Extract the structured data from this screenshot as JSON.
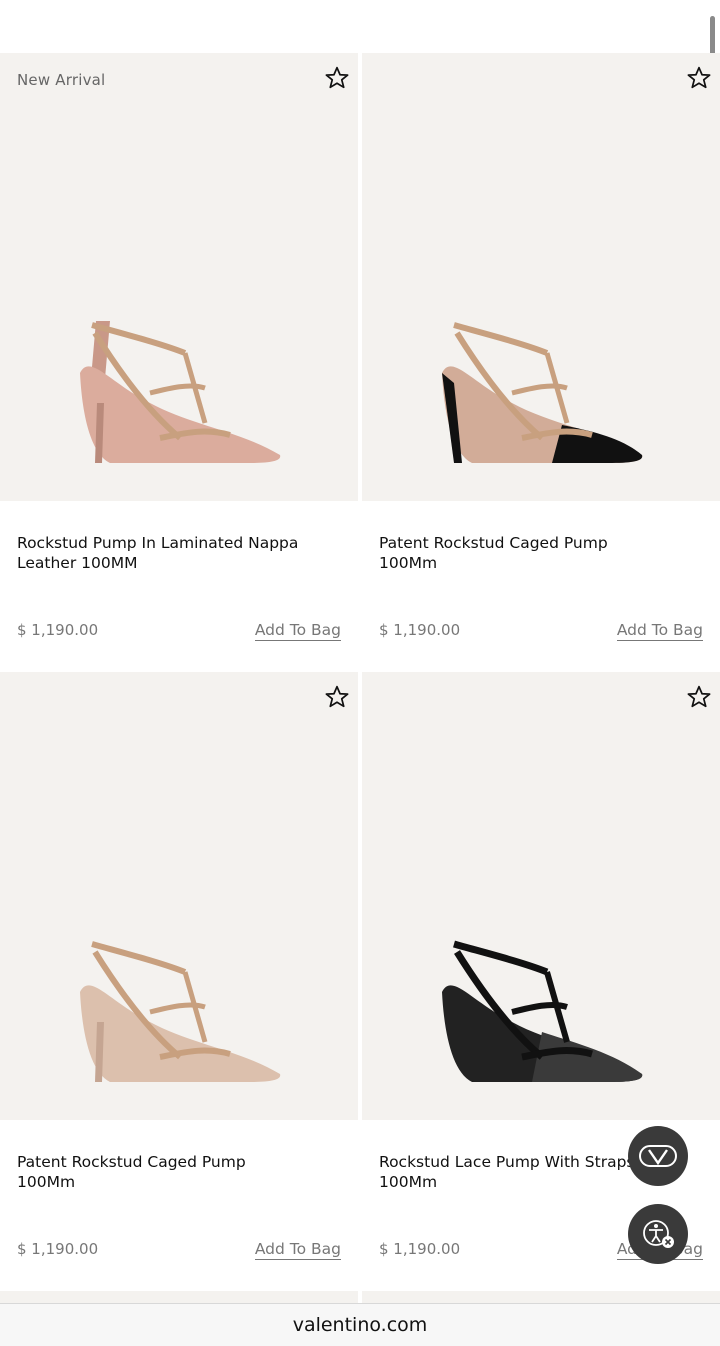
{
  "products": [
    {
      "tag": "New Arrival",
      "name": "Rockstud Pump In Laminated Nappa Leather 100MM",
      "price": "$ 1,190.00",
      "add_label": "Add To Bag",
      "shoe_color": "#d9a99a",
      "toe_color": "#d9a99a"
    },
    {
      "tag": "",
      "name": "Patent Rockstud Caged Pump 100Mm",
      "price": "$ 1,190.00",
      "add_label": "Add To Bag",
      "shoe_color": "#cfa893",
      "toe_color": "#111111"
    },
    {
      "tag": "",
      "name": "Patent Rockstud Caged Pump 100Mm",
      "price": "$ 1,190.00",
      "add_label": "Add To Bag",
      "shoe_color": "#d8b9a7",
      "toe_color": "#dcc0ad"
    },
    {
      "tag": "",
      "name": "Rockstud Lace Pump With Straps 100Mm",
      "price": "$ 1,190.00",
      "add_label": "Add To Bag",
      "shoe_color": "#1a1a1a",
      "toe_color": "#2a2a2a"
    }
  ],
  "footer": {
    "domain": "valentino.com"
  },
  "colors": {
    "image_bg": "#f4f2ef",
    "muted_text": "#777777",
    "fab_bg": "#3a3a3a"
  },
  "icons": {
    "wishlist": "star-outline-icon",
    "brand": "valentino-v-logo",
    "accessibility": "accessibility-icon"
  }
}
